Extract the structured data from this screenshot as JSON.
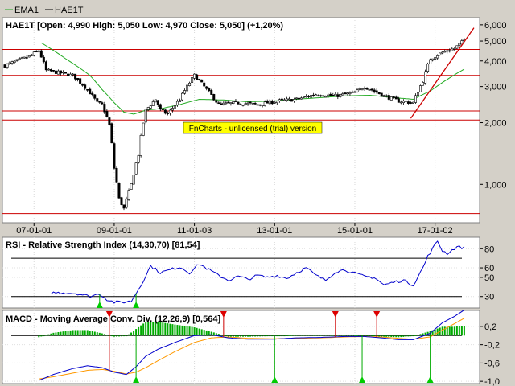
{
  "legend": [
    {
      "name": "EMA1",
      "color": "#22aa22"
    },
    {
      "name": "HAE1T",
      "color": "#000000"
    }
  ],
  "watermark": "FnCharts - unlicensed (trial) version",
  "price_panel": {
    "title": "HAE1T [Open: 4,990  High: 5,050  Low: 4,970  Close: 5,050] (+1,20%)",
    "y_scale": "log",
    "y_range": [
      650,
      6500
    ],
    "y_ticks": [
      {
        "value": 6000,
        "label": "6,000"
      },
      {
        "value": 5000,
        "label": "5,000"
      },
      {
        "value": 4000,
        "label": "4,000"
      },
      {
        "value": 3000,
        "label": "3,000"
      },
      {
        "value": 2000,
        "label": "2,000"
      },
      {
        "value": 1000,
        "label": "1,000"
      }
    ],
    "x_ticks": [
      {
        "index": 12,
        "label": "07-01-01"
      },
      {
        "index": 45,
        "label": "09-01-01"
      },
      {
        "index": 78,
        "label": "11-01-03"
      },
      {
        "index": 111,
        "label": "13-01-01"
      },
      {
        "index": 144,
        "label": "15-01-01"
      },
      {
        "index": 177,
        "label": "17-01-02"
      }
    ],
    "horizontal_levels": [
      4550,
      3400,
      2280,
      2060,
      720
    ],
    "trendline": [
      {
        "index": 167,
        "value": 2100
      },
      {
        "index": 193,
        "value": 5800
      }
    ],
    "ema_color": "#22aa22",
    "level_color": "#cc0000"
  },
  "rsi_panel": {
    "title": "RSI - Relative Strength Index (14,30,70) [81,54]",
    "y_range": [
      18,
      92
    ],
    "levels": [
      70,
      30
    ],
    "y_ticks": [
      {
        "value": 80,
        "label": "80"
      },
      {
        "value": 60,
        "label": "60"
      },
      {
        "value": 50,
        "label": "50"
      },
      {
        "value": 30,
        "label": "30"
      }
    ],
    "buy_signals": [
      39,
      54
    ],
    "line_color": "#0000cc"
  },
  "macd_panel": {
    "title": "MACD - Moving Average Conv. Div. (12,26,9) [0,564]",
    "y_range": [
      -1.05,
      0.55
    ],
    "y_ticks": [
      {
        "value": 0.2,
        "label": "0,2"
      },
      {
        "value": -0.2,
        "label": "-0,2"
      },
      {
        "value": -0.6,
        "label": "-0,6"
      },
      {
        "value": -1.0,
        "label": "-1,0"
      }
    ],
    "buy_signals": [
      54,
      111,
      147,
      175
    ],
    "sell_signals": [
      43,
      90,
      136,
      153
    ],
    "macd_color": "#0000cc",
    "signal_color": "#ff9900",
    "hist_color": "#00aa00"
  },
  "chart_data": [
    {
      "type": "candlestick",
      "title": "HAE1T [Open: 4,990  High: 5,050  Low: 4,970  Close: 5,050] (+1,20%)",
      "x": [
        "07-01-01",
        "09-01-01",
        "11-01-03",
        "13-01-01",
        "15-01-01",
        "17-01-02"
      ],
      "series": [
        {
          "name": "HAE1T",
          "anchors": [
            [
              0,
              3800
            ],
            [
              10,
              4200
            ],
            [
              14,
              4500
            ],
            [
              17,
              3600
            ],
            [
              28,
              3400
            ],
            [
              34,
              2900
            ],
            [
              38,
              2500
            ],
            [
              40,
              2450
            ],
            [
              43,
              1950
            ],
            [
              45,
              1200
            ],
            [
              47,
              850
            ],
            [
              49,
              760
            ],
            [
              52,
              1000
            ],
            [
              55,
              1400
            ],
            [
              58,
              2300
            ],
            [
              62,
              2600
            ],
            [
              64,
              2300
            ],
            [
              67,
              2200
            ],
            [
              72,
              2600
            ],
            [
              78,
              3400
            ],
            [
              83,
              2900
            ],
            [
              88,
              2450
            ],
            [
              96,
              2500
            ],
            [
              104,
              2450
            ],
            [
              112,
              2550
            ],
            [
              120,
              2600
            ],
            [
              128,
              2750
            ],
            [
              136,
              2700
            ],
            [
              144,
              2800
            ],
            [
              148,
              3000
            ],
            [
              156,
              2700
            ],
            [
              162,
              2550
            ],
            [
              168,
              2500
            ],
            [
              172,
              3200
            ],
            [
              175,
              4100
            ],
            [
              180,
              4400
            ],
            [
              185,
              4600
            ],
            [
              189,
              5050
            ]
          ]
        },
        {
          "name": "EMA1",
          "anchors": [
            [
              15,
              4900
            ],
            [
              25,
              4100
            ],
            [
              35,
              3400
            ],
            [
              40,
              2900
            ],
            [
              45,
              2500
            ],
            [
              49,
              2250
            ],
            [
              53,
              2200
            ],
            [
              58,
              2300
            ],
            [
              65,
              2350
            ],
            [
              72,
              2450
            ],
            [
              80,
              2600
            ],
            [
              90,
              2580
            ],
            [
              100,
              2530
            ],
            [
              110,
              2550
            ],
            [
              120,
              2600
            ],
            [
              130,
              2650
            ],
            [
              140,
              2700
            ],
            [
              150,
              2720
            ],
            [
              160,
              2650
            ],
            [
              168,
              2600
            ],
            [
              175,
              2850
            ],
            [
              182,
              3250
            ],
            [
              189,
              3650
            ]
          ]
        }
      ],
      "ylim": [
        650,
        6500
      ]
    },
    {
      "type": "line",
      "title": "RSI - Relative Strength Index (14,30,70) [81,54]",
      "series": [
        {
          "name": "RSI",
          "anchors": [
            [
              19,
              34
            ],
            [
              25,
              34
            ],
            [
              30,
              33
            ],
            [
              35,
              30
            ],
            [
              39,
              33
            ],
            [
              42,
              27
            ],
            [
              45,
              24
            ],
            [
              48,
              24
            ],
            [
              52,
              25
            ],
            [
              56,
              42
            ],
            [
              60,
              62
            ],
            [
              64,
              55
            ],
            [
              68,
              58
            ],
            [
              72,
              61
            ],
            [
              76,
              55
            ],
            [
              80,
              64
            ],
            [
              84,
              58
            ],
            [
              88,
              52
            ],
            [
              92,
              47
            ],
            [
              96,
              51
            ],
            [
              100,
              48
            ],
            [
              104,
              52
            ],
            [
              108,
              50
            ],
            [
              112,
              52
            ],
            [
              116,
              49
            ],
            [
              120,
              55
            ],
            [
              124,
              60
            ],
            [
              128,
              52
            ],
            [
              132,
              47
            ],
            [
              136,
              56
            ],
            [
              140,
              58
            ],
            [
              144,
              54
            ],
            [
              148,
              51
            ],
            [
              152,
              50
            ],
            [
              156,
              42
            ],
            [
              160,
              45
            ],
            [
              164,
              47
            ],
            [
              168,
              42
            ],
            [
              172,
              60
            ],
            [
              174,
              72
            ],
            [
              178,
              88
            ],
            [
              180,
              78
            ],
            [
              182,
              75
            ],
            [
              186,
              82
            ],
            [
              189,
              81
            ]
          ]
        }
      ],
      "levels": [
        70,
        30
      ],
      "ylim": [
        18,
        92
      ]
    },
    {
      "type": "line",
      "title": "MACD - Moving Average Conv. Div. (12,26,9) [0,564]",
      "series": [
        {
          "name": "MACD",
          "anchors": [
            [
              14,
              -0.98
            ],
            [
              20,
              -0.85
            ],
            [
              28,
              -0.72
            ],
            [
              34,
              -0.66
            ],
            [
              40,
              -0.7
            ],
            [
              45,
              -0.8
            ],
            [
              50,
              -0.85
            ],
            [
              54,
              -0.68
            ],
            [
              58,
              -0.45
            ],
            [
              63,
              -0.3
            ],
            [
              70,
              -0.15
            ],
            [
              78,
              0.0
            ],
            [
              85,
              0.02
            ],
            [
              92,
              -0.05
            ],
            [
              100,
              -0.08
            ],
            [
              110,
              -0.08
            ],
            [
              120,
              -0.05
            ],
            [
              130,
              -0.04
            ],
            [
              140,
              -0.02
            ],
            [
              148,
              -0.02
            ],
            [
              155,
              -0.05
            ],
            [
              162,
              -0.09
            ],
            [
              168,
              -0.09
            ],
            [
              175,
              0.05
            ],
            [
              180,
              0.28
            ],
            [
              185,
              0.42
            ],
            [
              189,
              0.56
            ]
          ]
        },
        {
          "name": "Signal",
          "anchors": [
            [
              14,
              -0.95
            ],
            [
              20,
              -0.9
            ],
            [
              28,
              -0.82
            ],
            [
              34,
              -0.76
            ],
            [
              40,
              -0.74
            ],
            [
              45,
              -0.78
            ],
            [
              50,
              -0.84
            ],
            [
              54,
              -0.8
            ],
            [
              58,
              -0.7
            ],
            [
              63,
              -0.55
            ],
            [
              70,
              -0.35
            ],
            [
              78,
              -0.15
            ],
            [
              85,
              -0.05
            ],
            [
              92,
              -0.03
            ],
            [
              100,
              -0.06
            ],
            [
              110,
              -0.07
            ],
            [
              120,
              -0.06
            ],
            [
              130,
              -0.05
            ],
            [
              140,
              -0.03
            ],
            [
              148,
              -0.02
            ],
            [
              155,
              -0.03
            ],
            [
              162,
              -0.06
            ],
            [
              168,
              -0.08
            ],
            [
              175,
              -0.03
            ],
            [
              180,
              0.12
            ],
            [
              185,
              0.26
            ],
            [
              189,
              0.38
            ]
          ]
        }
      ],
      "ylim": [
        -1.05,
        0.55
      ]
    }
  ]
}
